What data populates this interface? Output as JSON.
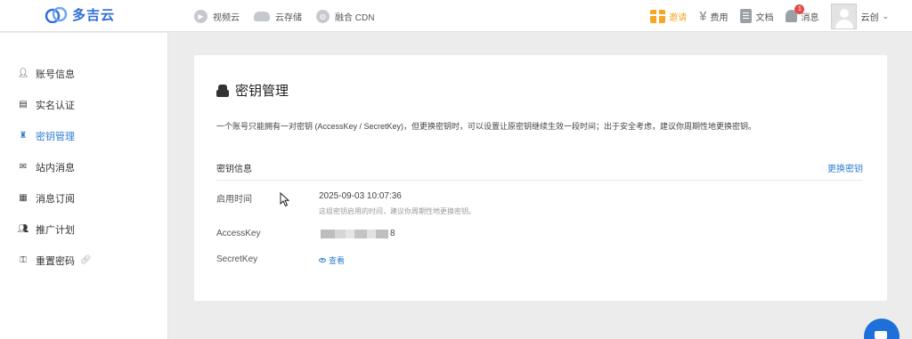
{
  "header": {
    "logo_text": "多吉云",
    "nav": [
      {
        "label": "视频云",
        "icon": "play-circle-icon"
      },
      {
        "label": "云存储",
        "icon": "cloud-storage-icon"
      },
      {
        "label": "融合 CDN",
        "icon": "globe-icon"
      }
    ],
    "right": {
      "invite_label": "邀请",
      "billing_label": "费用",
      "docs_label": "文档",
      "messages_label": "消息",
      "messages_badge": "1",
      "user_name": "云创"
    }
  },
  "sidebar": {
    "items": [
      {
        "label": "账号信息",
        "icon": "user-icon"
      },
      {
        "label": "实名认证",
        "icon": "id-card-icon"
      },
      {
        "label": "密钥管理",
        "icon": "spy-icon",
        "active": true
      },
      {
        "label": "站内消息",
        "icon": "envelope-icon"
      },
      {
        "label": "消息订阅",
        "icon": "newspaper-icon"
      },
      {
        "label": "推广计划",
        "icon": "users-icon"
      },
      {
        "label": "重置密码",
        "icon": "key-icon"
      }
    ]
  },
  "main": {
    "title": "密钥管理",
    "description": "一个账号只能拥有一对密钥 (AccessKey / SecretKey)，但更换密钥时，可以设置让原密钥继续生效一段时间；出于安全考虑，建议你周期性地更换密钥。",
    "section_title": "密钥信息",
    "section_action": "更换密钥",
    "rows": {
      "enabled_label": "启用时间",
      "enabled_value": "2025-09-03 10:07:36",
      "enabled_hint": "这组密钥启用的时间，建议你周期性地更换密钥。",
      "access_label": "AccessKey",
      "access_tail": "8",
      "secret_label": "SecretKey",
      "view_label": "查看"
    }
  },
  "colors": {
    "accent": "#2f7dd1",
    "invite": "#f5a623",
    "badge": "#e34b4b",
    "chat": "#1e6fd9"
  }
}
